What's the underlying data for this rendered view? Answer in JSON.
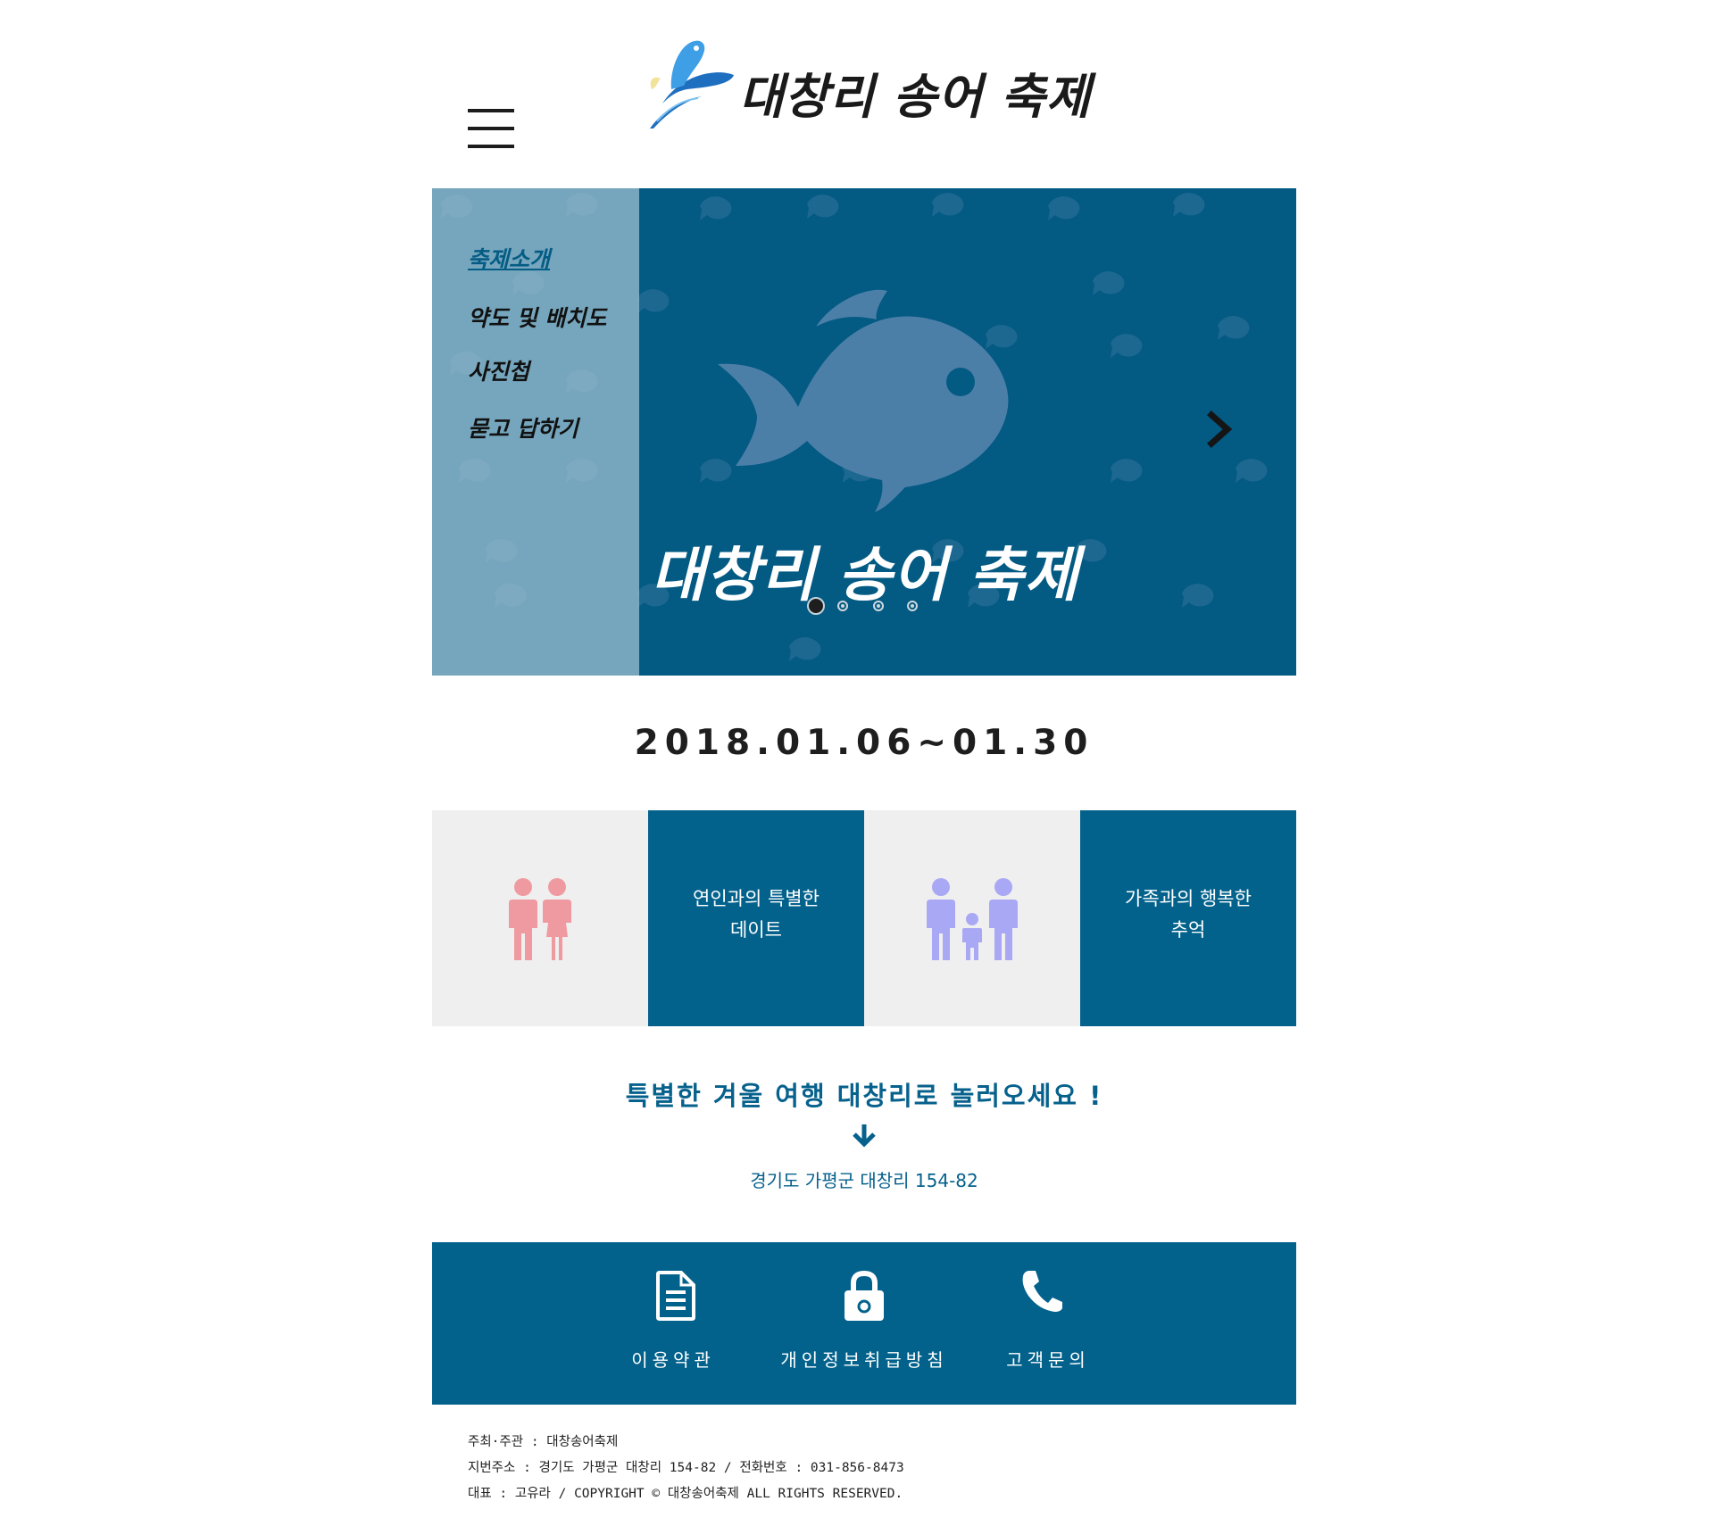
{
  "header": {
    "logo_text": "대창리 송어 축제",
    "menu_icon": "hamburger-menu-icon"
  },
  "hero": {
    "menu": [
      {
        "label": "축제소개",
        "active": true
      },
      {
        "label": "약도 및 배치도",
        "active": false
      },
      {
        "label": "사진첩",
        "active": false
      },
      {
        "label": "묻고 답하기",
        "active": false
      }
    ],
    "title": "대창리 송어 축제",
    "next_icon": "chevron-right-icon",
    "slide_count": 4,
    "active_slide": 1,
    "colors": {
      "background": "#035a83",
      "side_menu": "#a4c4d4",
      "fish": "#4c7fa8"
    }
  },
  "date": "2018.01.06~01.30",
  "tiles": [
    {
      "type": "icon",
      "icon": "couple-icon",
      "color": "#ef9aa0"
    },
    {
      "type": "caption",
      "line1": "연인과의 특별한",
      "line2": "데이트"
    },
    {
      "type": "icon",
      "icon": "family-icon",
      "color": "#a9a8f5"
    },
    {
      "type": "caption",
      "line1": "가족과의 행복한",
      "line2": "추억"
    }
  ],
  "invite": {
    "headline": "특별한 겨울 여행 대창리로 놀러오세요 !",
    "arrow_icon": "arrow-down-icon",
    "address": "경기도 가평군 대창리 154-82"
  },
  "links": [
    {
      "label": "이용약관",
      "icon": "document-icon"
    },
    {
      "label": "개인정보취급방침",
      "icon": "lock-icon"
    },
    {
      "label": "고객문의",
      "icon": "phone-icon"
    }
  ],
  "footer": {
    "line1": "주최·주관 : 대창송어축제",
    "line2": "지번주소 : 경기도 가평군 대창리 154-82  / 전화번호 : 031-856-8473",
    "line3": "대표 : 고유라 / COPYRIGHT © 대창송어축제 ALL RIGHTS RESERVED."
  },
  "colors": {
    "primary": "#03628c",
    "tile_grey": "#efefef",
    "text": "#1e1e1e"
  }
}
